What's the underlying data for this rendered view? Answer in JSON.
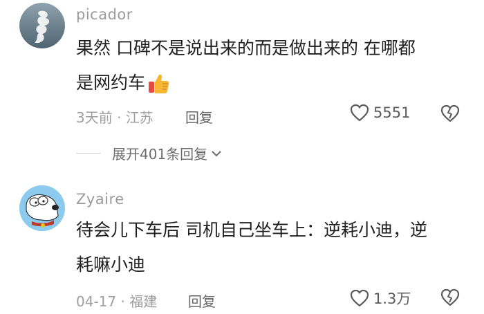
{
  "comments": [
    {
      "username": "picador",
      "line1": "果然  口碑不是说出来的而是做出来的  在哪都",
      "line2": "是网约车",
      "emoji": "thumbs-up-emoji",
      "time": "3天前",
      "location": "江苏",
      "reply_label": "回复",
      "likes": "5551"
    },
    {
      "username": "Zyaire",
      "line1": "待会儿下车后 司机自己坐车上：逆耗小迪，逆",
      "line2": "耗嘛小迪",
      "time": "04-17",
      "location": "福建",
      "reply_label": "回复",
      "likes": "1.3万"
    }
  ],
  "expand_replies": {
    "label": "展开401条回复",
    "icon": "chevron-down-icon"
  },
  "icons": {
    "like": "heart-outline-icon",
    "dislike": "broken-heart-icon"
  },
  "colors": {
    "username": "#9b9b9b",
    "meta": "#9e9e9e",
    "text": "#1f1f1f"
  }
}
